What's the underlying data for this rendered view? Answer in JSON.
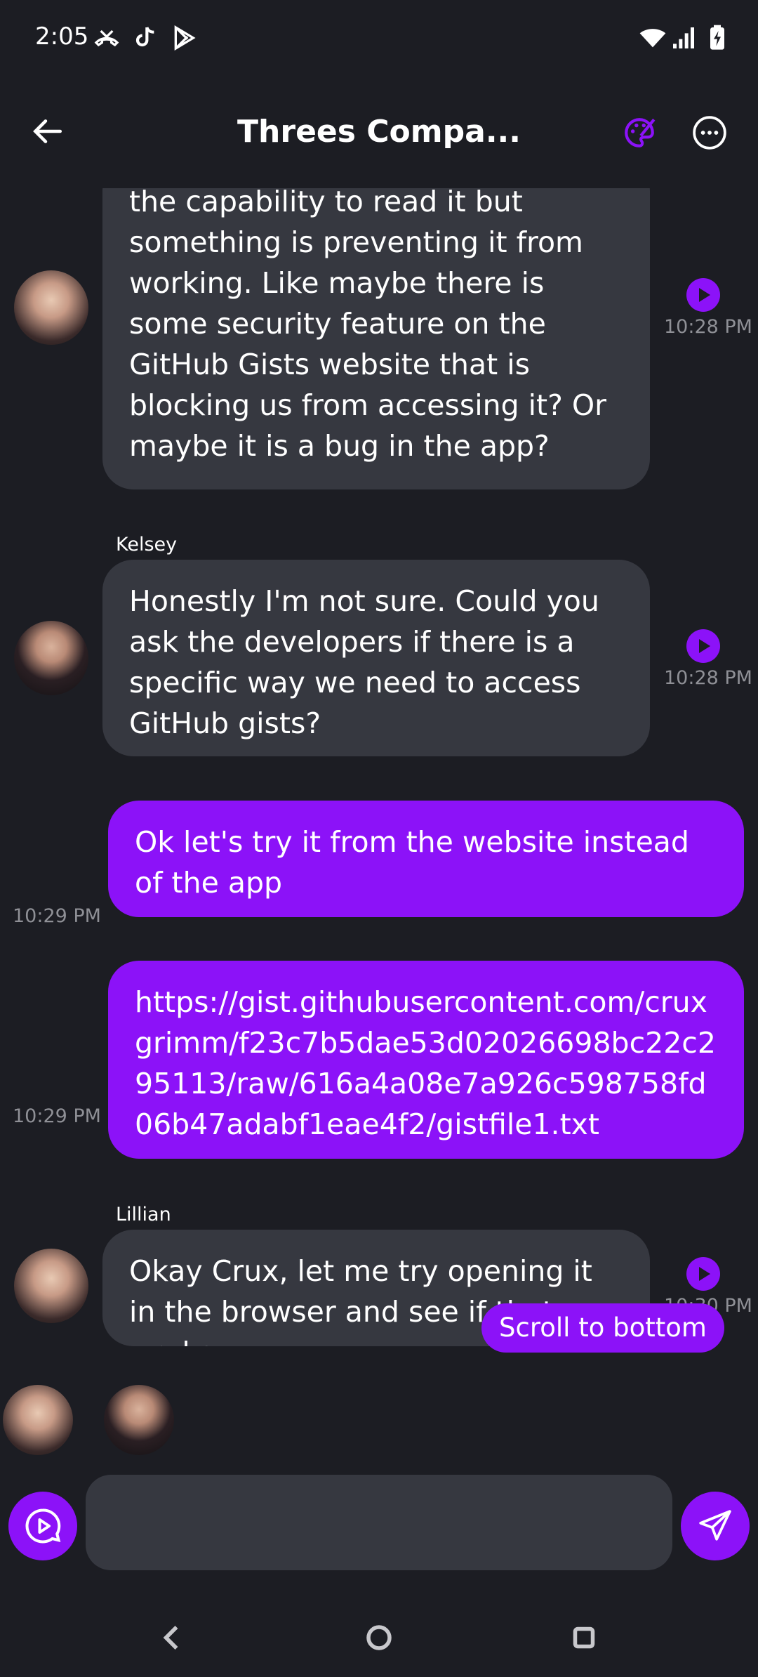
{
  "status": {
    "time": "2:05"
  },
  "header": {
    "title": "Threes Compa..."
  },
  "messages": [
    {
      "text": "the capability to read it but something is preventing it from working. Like maybe there is some security feature on the GitHub Gists website that is blocking us from accessing it? Or maybe it is a bug in the app?",
      "time": "10:28 PM"
    },
    {
      "sender": "Kelsey",
      "text": "Honestly I'm not sure. Could you ask the developers if there is a specific way we need to access GitHub gists?",
      "time": "10:28 PM"
    },
    {
      "text": "Ok let's try it from the website instead of the app",
      "time": "10:29 PM"
    },
    {
      "text": "https://gist.githubusercontent.com/cruxgrimm/f23c7b5dae53d02026698bc22c295113/raw/616a4a08e7a926c598758fd06b47adabf1eae4f2/gistfile1.txt",
      "time": "10:29 PM"
    },
    {
      "sender": "Lillian",
      "text": "Okay Crux, let me try opening it in the browser and see if that works",
      "time": "10:30 PM"
    }
  ],
  "scroll_button": "Scroll to bottom",
  "input": {
    "placeholder": ""
  },
  "colors": {
    "accent": "#8c12f8",
    "bubble": "#363840",
    "background": "#1c1d23"
  }
}
